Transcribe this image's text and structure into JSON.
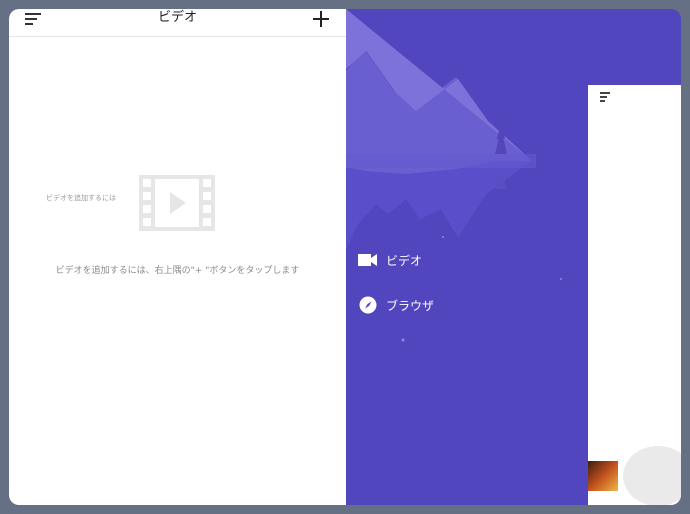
{
  "left": {
    "title": "ビデオ",
    "empty_message": "ビデオを追加するには、右上隅の\"+ \"ボタンをタップします",
    "menu_icon": "sort-lines-icon",
    "add_icon": "plus-icon",
    "empty_icon": "film-play-icon"
  },
  "drawer": {
    "items": [
      {
        "label": "ビデオ",
        "icon": "video-camera-icon"
      },
      {
        "label": "ブラウザ",
        "icon": "compass-icon"
      }
    ]
  },
  "preview": {
    "empty_message": "ビデオを追加するには"
  },
  "colors": {
    "accent": "#5246bf",
    "background": "#667085",
    "panel": "#ffffff"
  }
}
